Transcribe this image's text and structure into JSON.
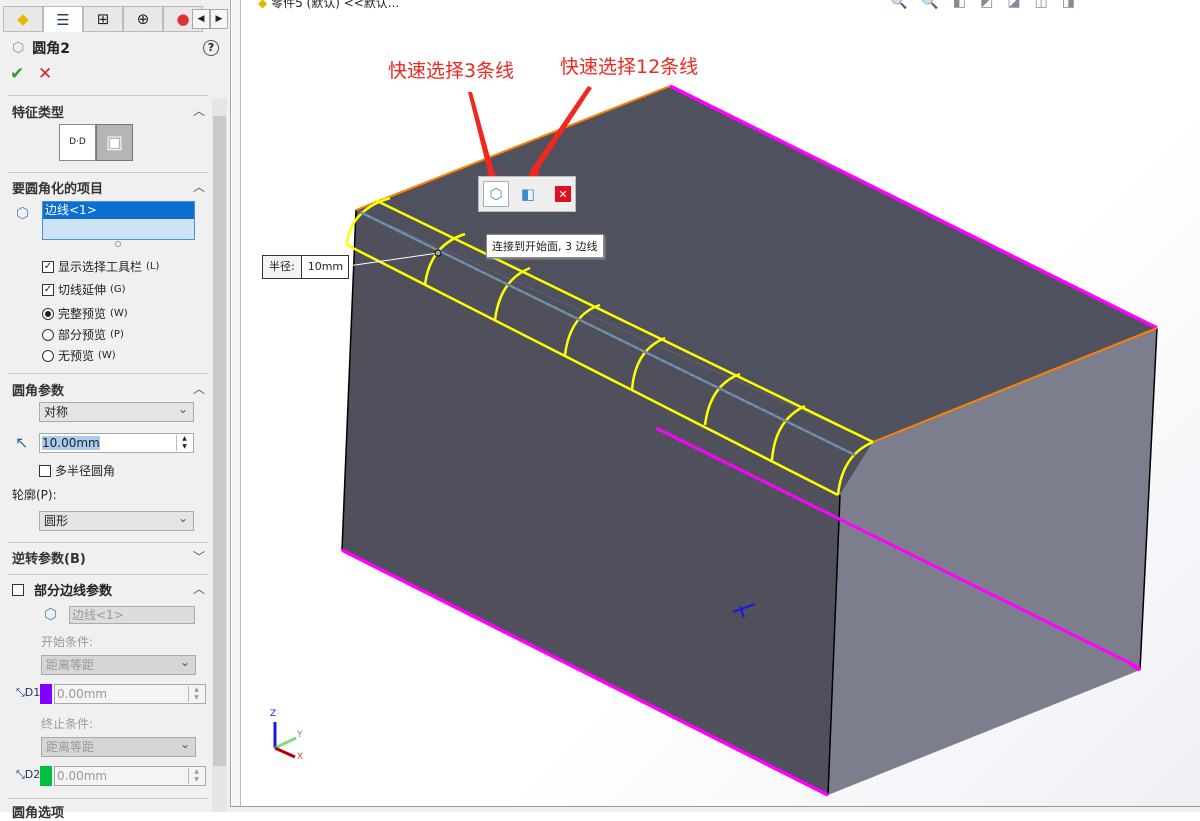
{
  "panel": {
    "tabs": [
      "feature-manager",
      "property-manager",
      "configuration-manager",
      "dimxpert",
      "appearance"
    ],
    "title": "圆角2",
    "ok": "✔",
    "cancel": "✕",
    "help": "?",
    "feature_type": {
      "header": "特征类型"
    },
    "items": {
      "header": "要圆角化的项目",
      "selection": "边线<1>",
      "show_toolbar": {
        "label": "显示选择工具栏",
        "key": "(L)",
        "checked": true
      },
      "tangent": {
        "label": "切线延伸",
        "key": "(G)",
        "checked": true
      },
      "preview": [
        {
          "label": "完整预览",
          "key": "(W)",
          "selected": true
        },
        {
          "label": "部分预览",
          "key": "(P)",
          "selected": false
        },
        {
          "label": "无预览",
          "key": "(W)",
          "selected": false
        }
      ]
    },
    "params": {
      "header": "圆角参数",
      "method": "对称",
      "radius": "10.00mm",
      "multi_radius": {
        "label": "多半径圆角",
        "checked": false
      },
      "profile_label": "轮廓(P):",
      "profile": "圆形"
    },
    "setback": {
      "header": "逆转参数(B)"
    },
    "partial": {
      "header": "部分边线参数",
      "checked": false,
      "selection": "边线<1>",
      "start_label": "开始条件:",
      "start": "距离等距",
      "d1": "0.00mm",
      "d1_color": "#8000ff",
      "end_label": "终止条件:",
      "end": "距离等距",
      "d2": "0.00mm",
      "d2_color": "#00c040"
    },
    "options": {
      "header": "圆角选项"
    }
  },
  "view": {
    "doc_title": "零件5 (默认) <<默认...",
    "annotation_1": "快速选择3条线",
    "annotation_2": "快速选择12条线",
    "tooltip": "连接到开始面, 3 边线",
    "radius_label": "半径:",
    "radius_value": "10mm",
    "axes": {
      "z": "Z",
      "y": "Y",
      "x": "X"
    },
    "colors": {
      "selected_edge": "#ff00ff",
      "tangent_edge": "#ff8000",
      "fillet_preview": "#ffff00",
      "body": "#50515e"
    }
  }
}
